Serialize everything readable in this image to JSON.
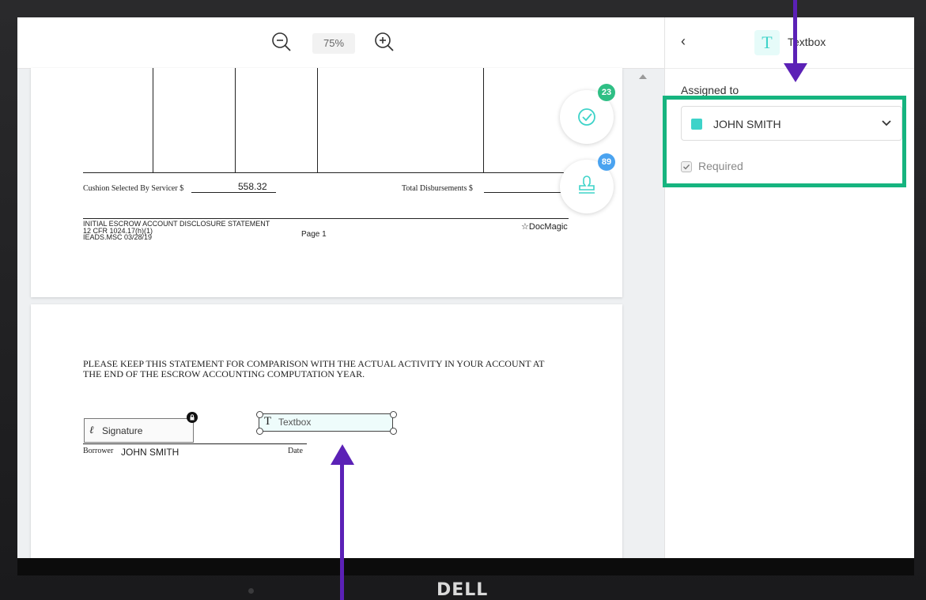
{
  "toolbar": {
    "zoom_level": "75%"
  },
  "page1": {
    "cushion_label": "Cushion Selected By Servicer $",
    "cushion_value": "558.32",
    "total_disbursements_label": "Total Disbursements $",
    "footer_title": "INITIAL ESCROW ACCOUNT DISCLOSURE STATEMENT",
    "footer_cfr": "12 CFR 1024.17(h)(1)",
    "footer_code": "IEADS.MSC  03/28/19",
    "page_number": "Page 1",
    "brand": "DocMagic"
  },
  "page2": {
    "statement_line1": "PLEASE KEEP THIS STATEMENT FOR COMPARISON WITH  THE ACTUAL ACTIVITY IN YOUR ACCOUNT AT",
    "statement_line2": "THE END OF THE ESCROW ACCOUNTING COMPUTATION YEAR.",
    "signature_field_label": "Signature",
    "textbox_field_label": "Textbox",
    "borrower_label": "Borrower",
    "borrower_name": "JOHN SMITH",
    "date_label": "Date"
  },
  "fabs": {
    "review_count": "23",
    "stamp_count": "89",
    "review_color": "#2fbf85",
    "stamp_color": "#4aa3f0"
  },
  "panel": {
    "title": "Textbox",
    "assigned_label": "Assigned to",
    "assignee": "JOHN SMITH",
    "required_label": "Required",
    "accent": "#3ed3c9"
  },
  "device": {
    "brand": "DELL"
  },
  "annotations": {
    "highlight_color": "#16b47f",
    "arrow_color": "#5b21b6"
  }
}
